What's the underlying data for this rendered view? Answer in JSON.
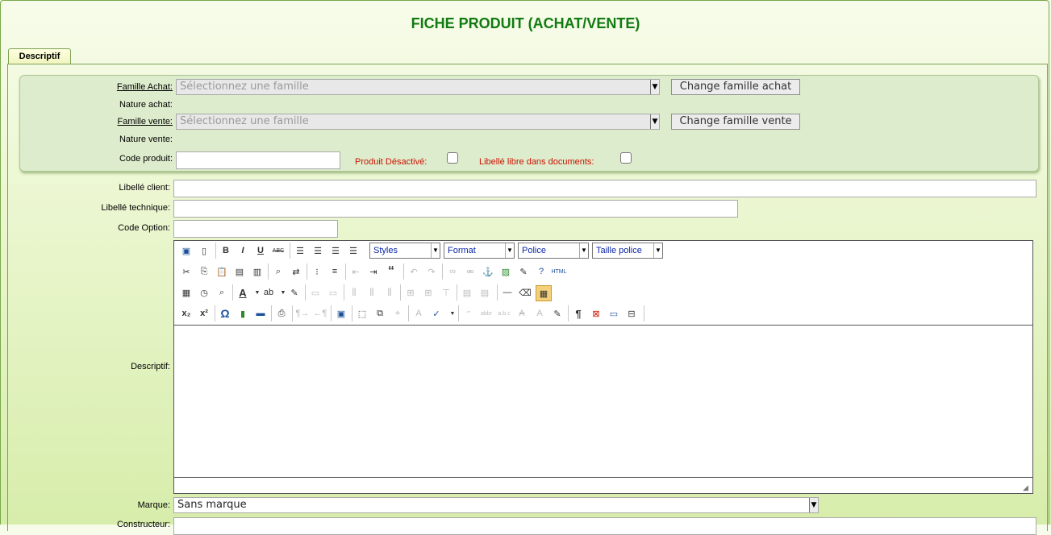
{
  "page": {
    "title": "FICHE PRODUIT (ACHAT/VENTE)"
  },
  "tabs": [
    {
      "label": "Descriptif"
    }
  ],
  "group": {
    "famille_achat": {
      "label": "Famille Achat:",
      "placeholder": "Sélectionnez une famille",
      "button": "Change famille achat"
    },
    "nature_achat": {
      "label": "Nature achat:"
    },
    "famille_vente": {
      "label": "Famille vente:",
      "placeholder": "Sélectionnez une famille",
      "button": "Change famille vente"
    },
    "nature_vente": {
      "label": "Nature vente:"
    },
    "code_produit": {
      "label": "Code produit:",
      "value": ""
    },
    "produit_desactive": {
      "label": "Produit Désactivé:",
      "checked": false
    },
    "libelle_libre": {
      "label": "Libellé libre dans documents:",
      "checked": false
    }
  },
  "fields": {
    "libelle_client": {
      "label": "Libellé client:",
      "value": ""
    },
    "libelle_technique": {
      "label": "Libellé technique:",
      "value": ""
    },
    "code_option": {
      "label": "Code Option:",
      "value": ""
    },
    "descriptif": {
      "label": "Descriptif:"
    },
    "marque": {
      "label": "Marque:",
      "value": "Sans marque"
    },
    "constructeur": {
      "label": "Constructeur:"
    }
  },
  "editor": {
    "dropdowns": {
      "styles": "Styles",
      "format": "Format",
      "police": "Police",
      "taille": "Taille police"
    },
    "icons": {
      "bold": "B",
      "italic": "I",
      "underline": "U",
      "strike": "ABC",
      "html": "HTML",
      "omega": "Ω",
      "pilcrow": "¶",
      "quote": "“",
      "subscript": "x₂",
      "superscript": "x²"
    }
  },
  "colors": {
    "title": "#117a11",
    "required_red": "#cc1100",
    "dropdown_text": "#0b26a5",
    "group_bg": "#ddeccc"
  }
}
